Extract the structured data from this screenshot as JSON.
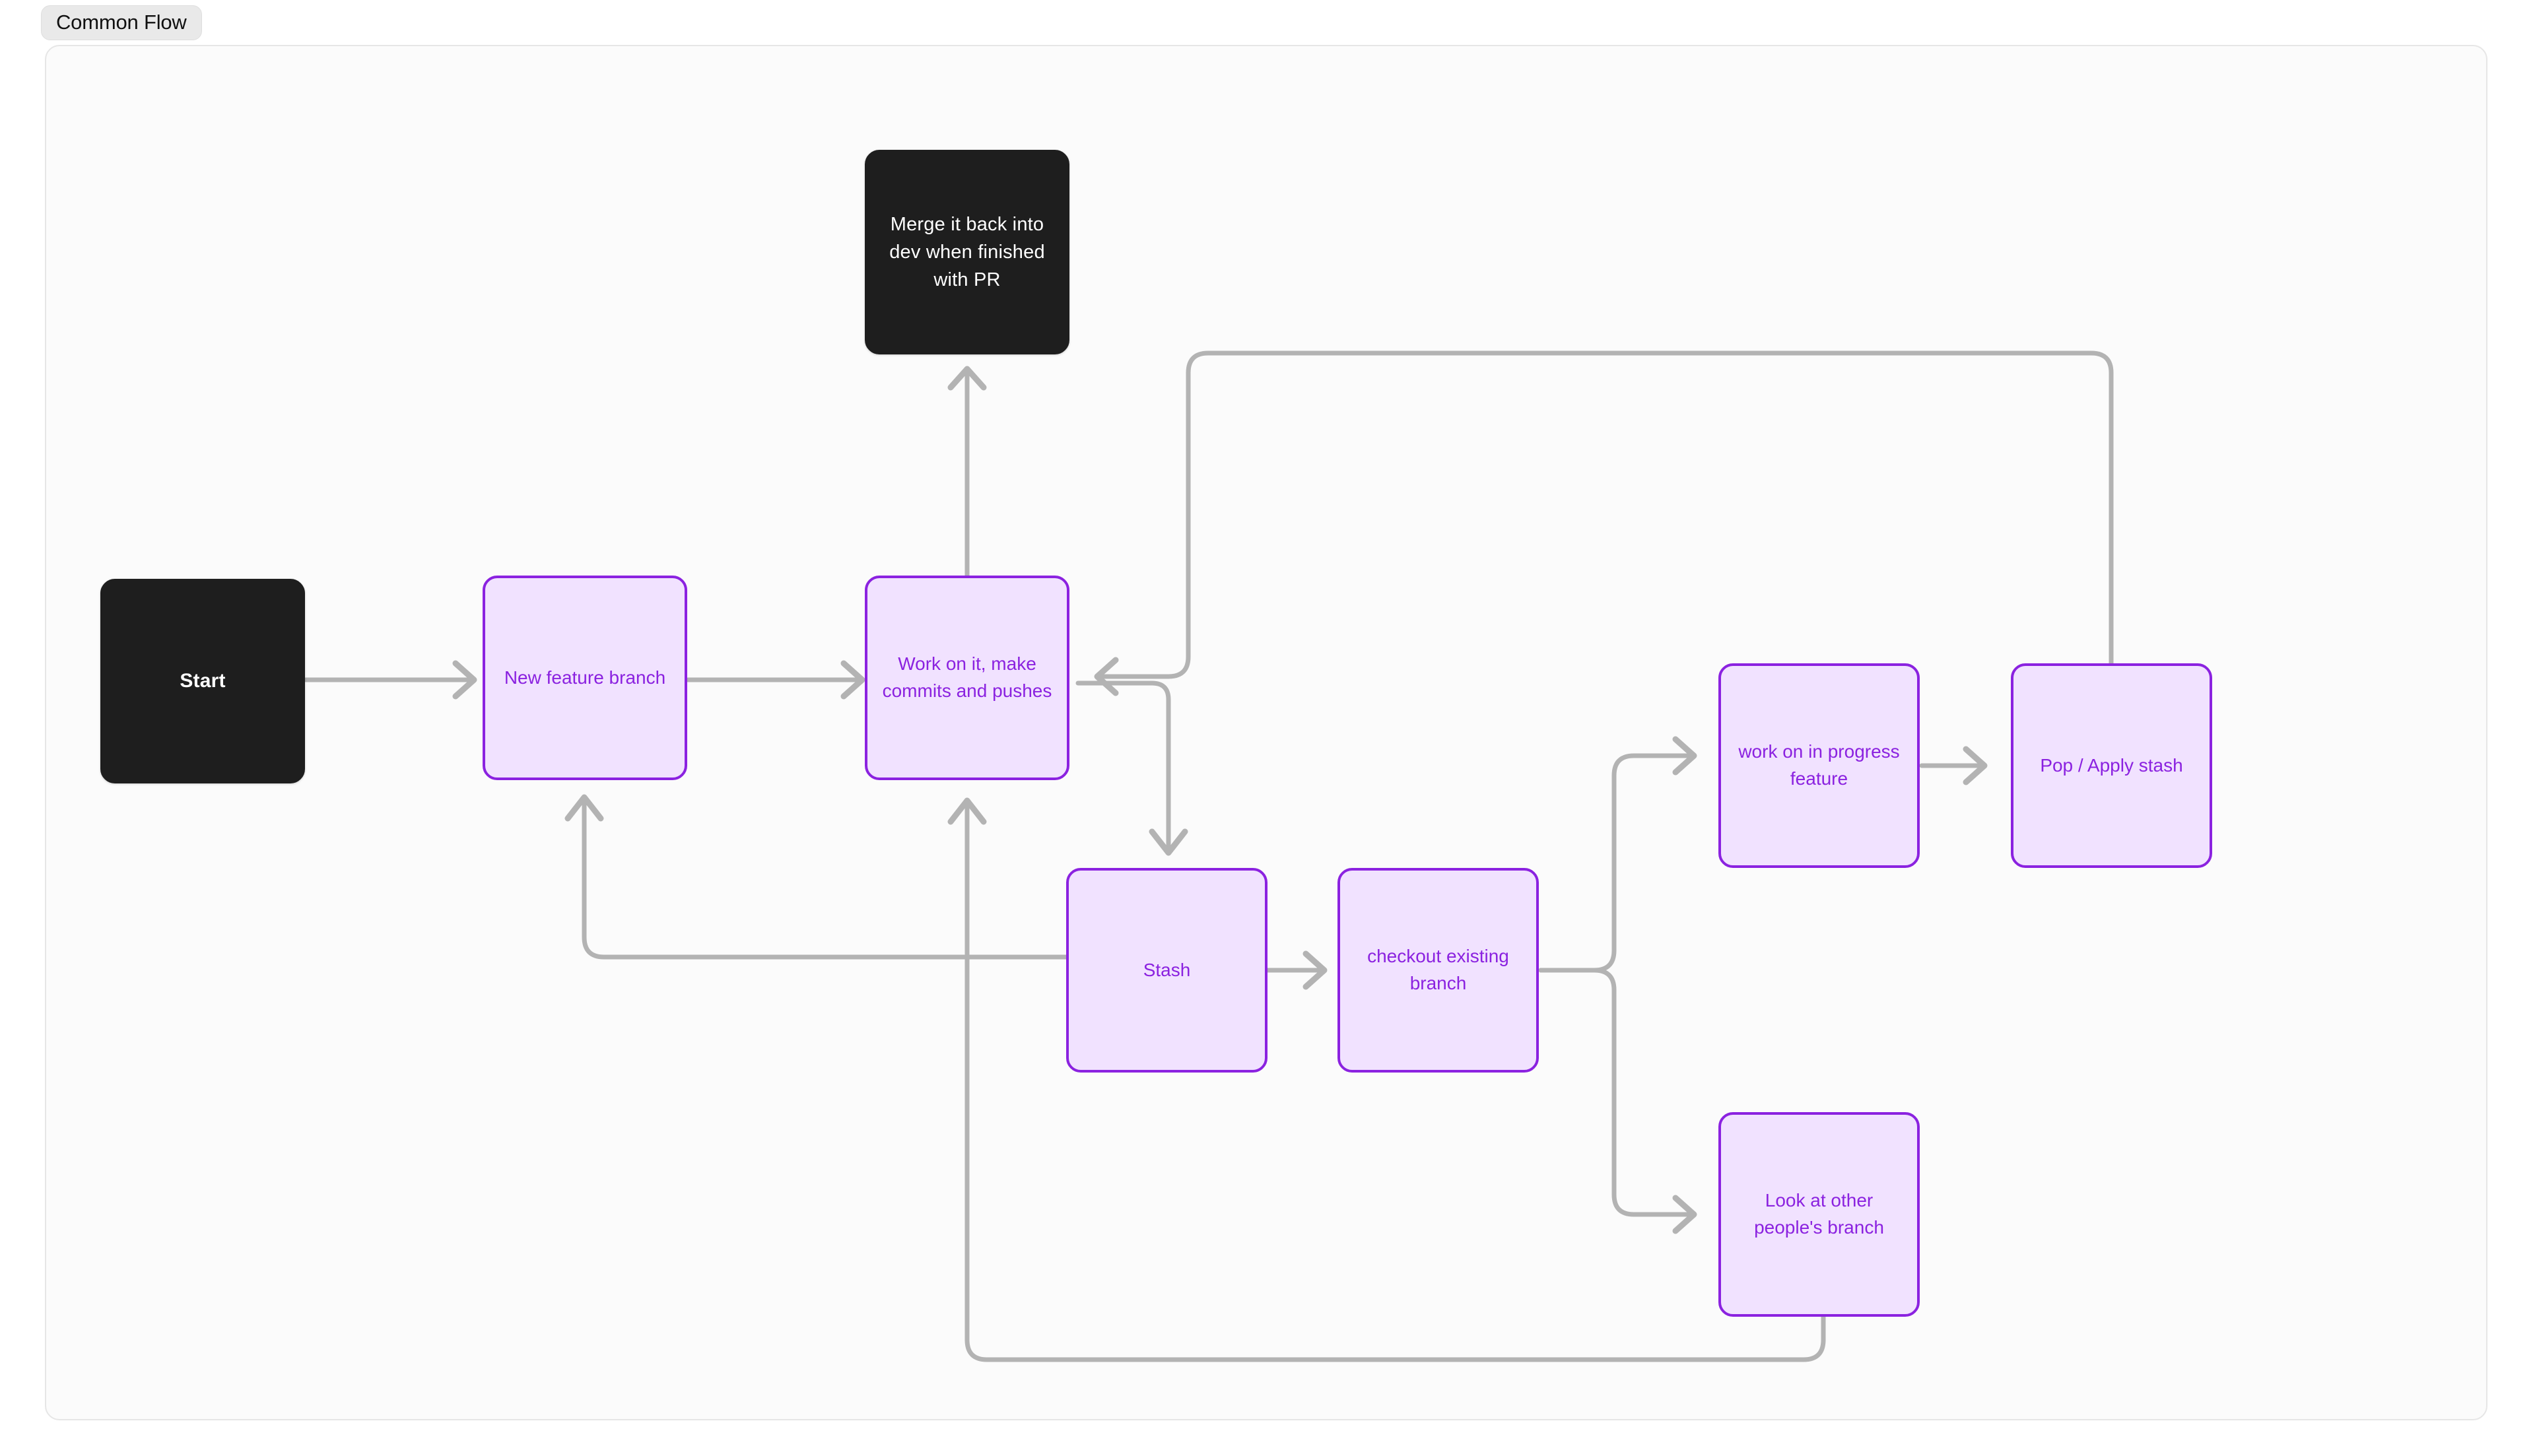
{
  "diagram": {
    "title": "Common Flow",
    "type": "flowchart",
    "colors": {
      "page_background": "#ffffff",
      "canvas_background": "#fbfbfb",
      "canvas_border": "#e6e6e6",
      "badge_background": "#e9e9e9",
      "dark_node_fill": "#1e1e1e",
      "dark_node_text": "#ffffff",
      "purple_node_fill": "#f1e2ff",
      "purple_node_border": "#8b22e0",
      "purple_node_text": "#8b22e0",
      "edge_stroke": "#b3b3b3"
    },
    "nodes": [
      {
        "id": "start",
        "label": "Start",
        "style": "dark"
      },
      {
        "id": "new_branch",
        "label": "New feature branch",
        "style": "purple"
      },
      {
        "id": "work",
        "label": "Work on it, make commits and pushes",
        "style": "purple"
      },
      {
        "id": "merge",
        "label": "Merge it back into dev when finished with PR",
        "style": "dark"
      },
      {
        "id": "stash",
        "label": "Stash",
        "style": "purple"
      },
      {
        "id": "checkout",
        "label": "checkout existing branch",
        "style": "purple"
      },
      {
        "id": "wip",
        "label": "work on in progress feature",
        "style": "purple"
      },
      {
        "id": "pop",
        "label": "Pop / Apply stash",
        "style": "purple"
      },
      {
        "id": "other_branch",
        "label": "Look at other people's branch",
        "style": "purple"
      }
    ],
    "edges": [
      {
        "from": "start",
        "to": "new_branch"
      },
      {
        "from": "new_branch",
        "to": "work"
      },
      {
        "from": "work",
        "to": "merge"
      },
      {
        "from": "work",
        "to": "stash"
      },
      {
        "from": "stash",
        "to": "checkout"
      },
      {
        "from": "stash",
        "to": "new_branch"
      },
      {
        "from": "checkout",
        "to": "wip"
      },
      {
        "from": "checkout",
        "to": "other_branch"
      },
      {
        "from": "wip",
        "to": "pop"
      },
      {
        "from": "pop",
        "to": "work"
      },
      {
        "from": "other_branch",
        "to": "work"
      }
    ]
  }
}
